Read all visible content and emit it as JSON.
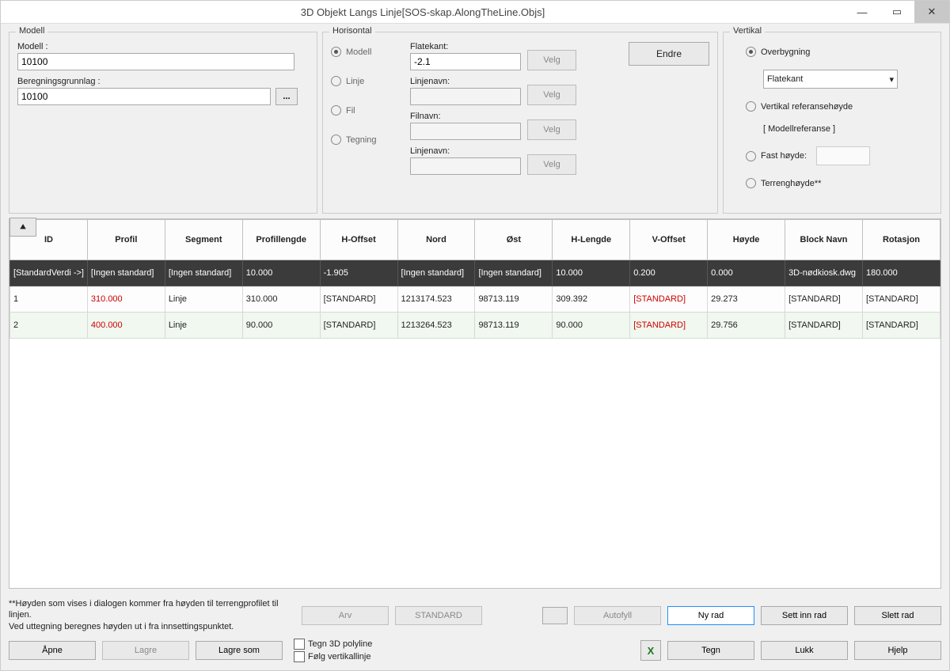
{
  "window": {
    "title": "3D Objekt Langs Linje[SOS-skap.AlongTheLine.Objs]"
  },
  "modell": {
    "legend": "Modell",
    "modell_label": "Modell :",
    "modell_value": "10100",
    "bg_label": "Beregningsgrunnlag :",
    "bg_value": "10100",
    "browse": "..."
  },
  "horisontal": {
    "legend": "Horisontal",
    "radios": {
      "modell": "Modell",
      "linje": "Linje",
      "fil": "Fil",
      "tegning": "Tegning"
    },
    "flatekant_label": "Flatekant:",
    "flatekant_value": "-2.1",
    "linjenavn_label": "Linjenavn:",
    "filnavn_label": "Filnavn:",
    "velg": "Velg",
    "endre": "Endre"
  },
  "vertikal": {
    "legend": "Vertikal",
    "overbygning": "Overbygning",
    "flatekant": "Flatekant",
    "vref": "Vertikal referansehøyde",
    "modellref": "[ Modellreferanse ]",
    "fast": "Fast høyde:",
    "terreng": "Terrenghøyde**"
  },
  "table": {
    "headers": [
      "ID",
      "Profil",
      "Segment",
      "Profillengde",
      "H-Offset",
      "Nord",
      "Øst",
      "H-Lengde",
      "V-Offset",
      "Høyde",
      "Block Navn",
      "Rotasjon"
    ],
    "std_row": [
      "[StandardVerdi ->]",
      "[Ingen standard]",
      "[Ingen standard]",
      "10.000",
      "-1.905",
      "[Ingen standard]",
      "[Ingen standard]",
      "10.000",
      "0.200",
      "0.000",
      "3D-nødkiosk.dwg",
      "180.000"
    ],
    "rows": [
      {
        "cells": [
          "1",
          "310.000",
          "Linje",
          "310.000",
          "[STANDARD]",
          "1213174.523",
          "98713.119",
          "309.392",
          "[STANDARD]",
          "29.273",
          "[STANDARD]",
          "[STANDARD]"
        ],
        "red": [
          1,
          8
        ]
      },
      {
        "cells": [
          "2",
          "400.000",
          "Linje",
          "90.000",
          "[STANDARD]",
          "1213264.523",
          "98713.119",
          "90.000",
          "[STANDARD]",
          "29.756",
          "[STANDARD]",
          "[STANDARD]"
        ],
        "red": [
          1,
          8
        ]
      }
    ]
  },
  "footer": {
    "note1": "**Høyden som vises i dialogen kommer fra høyden til terrengprofilet til linjen.",
    "note2": "Ved uttegning beregnes høyden ut i fra innsettingspunktet.",
    "arv": "Arv",
    "standard": "STANDARD",
    "autofyll": "Autofyll",
    "nyrad": "Ny rad",
    "settinn": "Sett inn rad",
    "slett": "Slett rad",
    "apne": "Åpne",
    "lagre": "Lagre",
    "lagresom": "Lagre som",
    "cb1": "Tegn 3D polyline",
    "cb2": "Følg vertikallinje",
    "tegn": "Tegn",
    "lukk": "Lukk",
    "hjelp": "Hjelp",
    "collapse": "⯅"
  }
}
